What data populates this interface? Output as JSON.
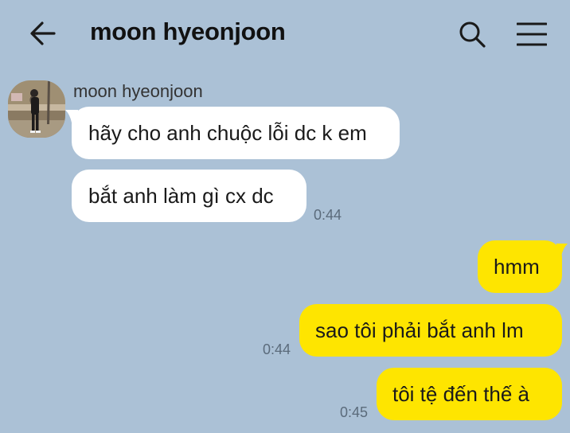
{
  "header": {
    "title": "moon hyeonjoon",
    "back_icon": "arrow-left-icon",
    "search_icon": "search-icon",
    "menu_icon": "hamburger-menu-icon"
  },
  "chat": {
    "sender_name": "moon hyeonjoon",
    "messages": [
      {
        "direction": "incoming",
        "text": "hãy cho anh chuộc lỗi dc k em",
        "time": ""
      },
      {
        "direction": "incoming",
        "text": "bắt anh làm gì cx dc",
        "time": "0:44"
      },
      {
        "direction": "outgoing",
        "text": "hmm",
        "time": ""
      },
      {
        "direction": "outgoing",
        "text": "sao tôi phải bắt anh lm",
        "time": "0:44"
      },
      {
        "direction": "outgoing",
        "text": "tôi tệ đến thế à",
        "time": "0:45"
      }
    ]
  },
  "colors": {
    "background": "#abc1d6",
    "incoming_bubble": "#ffffff",
    "outgoing_bubble": "#fee500"
  }
}
